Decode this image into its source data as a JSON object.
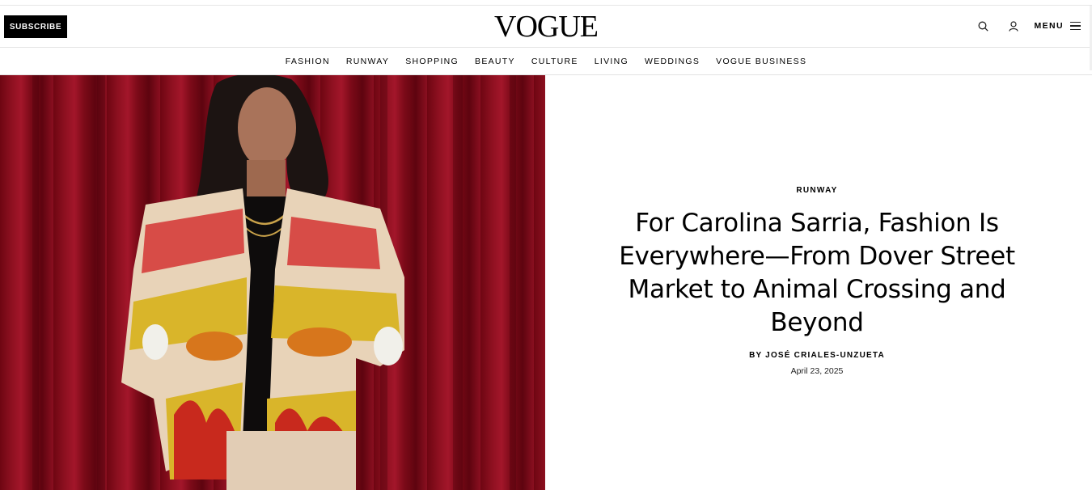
{
  "header": {
    "subscribe_label": "SUBSCRIBE",
    "logo_text": "VOGUE",
    "menu_label": "MENU",
    "icons": [
      "search-icon",
      "user-icon",
      "hamburger-icon"
    ]
  },
  "nav": {
    "items": [
      "FASHION",
      "RUNWAY",
      "SHOPPING",
      "BEAUTY",
      "CULTURE",
      "LIVING",
      "WEDDINGS",
      "VOGUE BUSINESS"
    ]
  },
  "article": {
    "kicker": "RUNWAY",
    "headline": "For Carolina Sarria, Fashion Is Everywhere—From Dover Street Market to Animal Crossing and Beyond",
    "byline": "BY JOSÉ CRIALES-UNZUETA",
    "date": "April 23, 2025"
  },
  "colors": {
    "curtain": "#8d1020",
    "jacket_cream": "#e8d3b8",
    "jacket_yellow": "#d9b52a",
    "jacket_red": "#d22a2a",
    "black": "#000000"
  }
}
